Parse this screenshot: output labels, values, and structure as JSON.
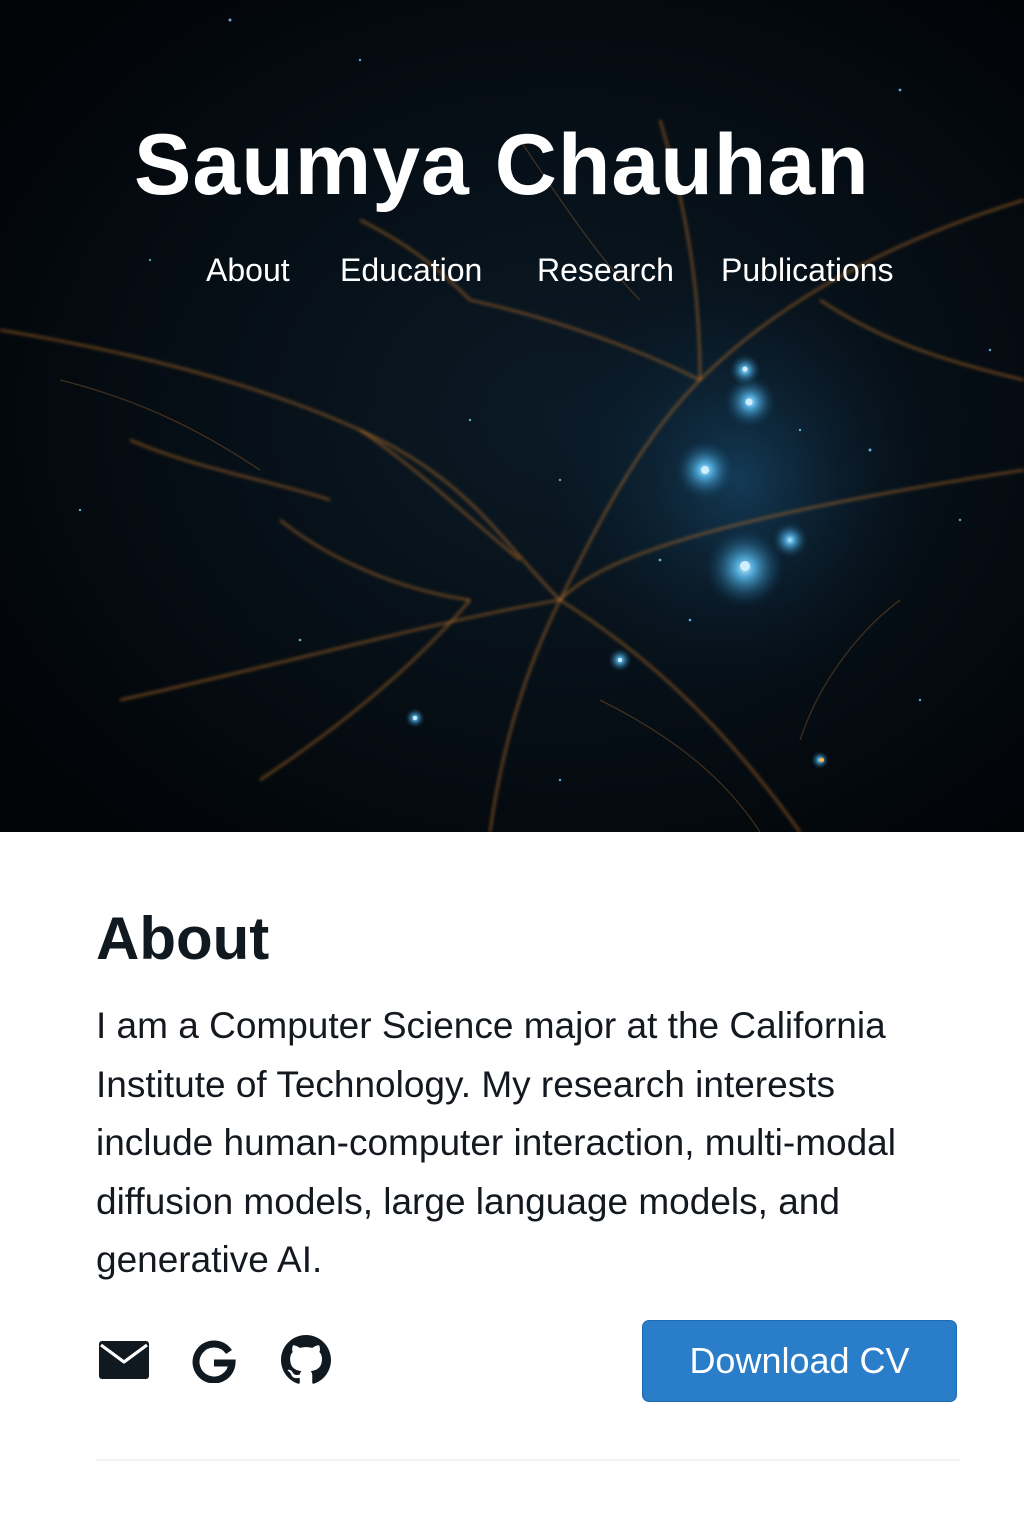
{
  "header": {
    "title": "Saumya Chauhan"
  },
  "nav": {
    "items": [
      {
        "label": "About"
      },
      {
        "label": "Education"
      },
      {
        "label": "Research"
      },
      {
        "label": "Publications"
      }
    ]
  },
  "about": {
    "heading": "About",
    "bio": "I am a Computer Science major at the California Institute of Technology. My research interests include human-computer interaction, multi-modal diffusion models, large language models, and generative AI."
  },
  "social": {
    "icons": [
      "mail-icon",
      "google-icon",
      "github-icon"
    ]
  },
  "actions": {
    "download_cv_label": "Download CV"
  },
  "colors": {
    "hero_background": "#03070c",
    "accent_button": "#2a7dc9",
    "text_dark": "#14191f",
    "filament_orange": "#c8782a",
    "star_blue": "#5ec8ff"
  }
}
